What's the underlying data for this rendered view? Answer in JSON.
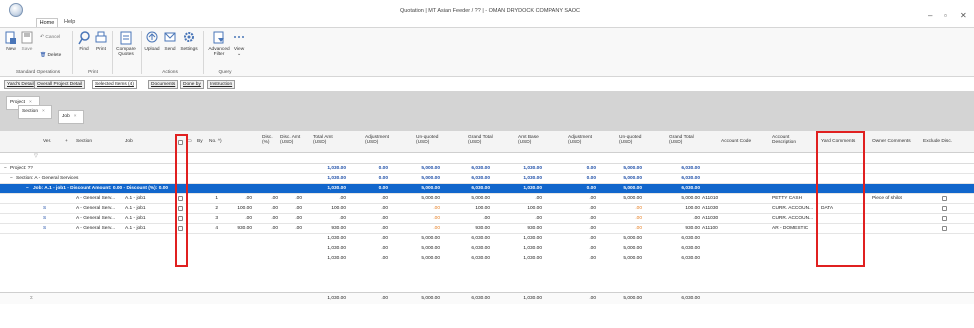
{
  "window": {
    "title": "Quotation | MT Asian Feeder / ?? | - OMAN DRYDOCK COMPANY SAOC",
    "controls": [
      "–",
      "▫",
      "✕"
    ]
  },
  "menu_tabs": [
    "Home",
    "Help"
  ],
  "ribbon": {
    "buttons": {
      "new": "New",
      "save": "Save",
      "cancel": "Cancel",
      "delete": "Delete",
      "find": "Find",
      "print": "Print",
      "compare": "Compare Quotes",
      "upload": "Upload",
      "send": "Send",
      "settings": "Settings",
      "advanced_filter": "Advanced Filter",
      "view": "View"
    },
    "groups": {
      "standard": "Standard Operations",
      "print": "Print",
      "actions": "Actions",
      "query": "Query"
    }
  },
  "panel_tabs": [
    "Yard's Detail",
    "Overall Project Detail",
    "Selected Items (4)",
    "Documents",
    "Done by",
    "Instruction"
  ],
  "group_by": [
    "Project",
    "Section",
    "Job"
  ],
  "columns": {
    "ver": "Ver.",
    "plus": "+",
    "section": "Section",
    "job": "Job",
    "by": "By",
    "no": "No.",
    "disc_pct": "Disc. (%)",
    "disc_amt": "Disc. Amt (USD)",
    "total_amt": "Total Amt (USD)",
    "adjustment": "Adjustment (USD)",
    "unquoted": "Un-quoted (USD)",
    "grand_total": "Grand Total (USD)",
    "amt_base": "Amt Base (USD)",
    "adjustment2": "Adjustment (USD)",
    "unquoted2": "Un-quoted (USD)",
    "grand_total2": "Grand Total (USD)",
    "account_code": "Account Code",
    "account_desc": "Account Description",
    "yard_comments": "Yard Comments",
    "owner_comments": "Owner Comments",
    "exclude_disc": "Exclude Disc."
  },
  "groups": {
    "project": {
      "label": "Project: ??",
      "total_amt": "1,030.00",
      "adjustment": "0.00",
      "unquoted": "5,000.00",
      "grand_total": "6,030.00",
      "amt_base": "1,030.00",
      "adjustment2": "0.00",
      "unquoted2": "5,000.00",
      "grand_total2": "6,030.00"
    },
    "section": {
      "label": "Section: A - General Services",
      "total_amt": "1,030.00",
      "adjustment": "0.00",
      "unquoted": "5,000.00",
      "grand_total": "6,030.00",
      "amt_base": "1,030.00",
      "adjustment2": "0.00",
      "unquoted2": "5,000.00",
      "grand_total2": "6,030.00"
    },
    "job": {
      "label": "Job: A.1 - job1 - Discount Amount: 0.00 - Discount (%): 0.00",
      "total_amt": "1,030.00",
      "adjustment": "0.00",
      "unquoted": "5,000.00",
      "grand_total": "6,030.00",
      "amt_base": "1,030.00",
      "adjustment2": "0.00",
      "unquoted2": "5,000.00",
      "grand_total2": "6,030.00"
    }
  },
  "rows": [
    {
      "ver": "",
      "section": "A - General Serv...",
      "job": "A.1 - job1",
      "no": "1",
      "col1": ".00",
      "disc_pct": ".00",
      "disc_amt": ".00",
      "total_amt": ".00",
      "adjustment": ".00",
      "unquoted": "5,000.00",
      "grand_total": "5,000.00",
      "amt_base": ".00",
      "adjustment2": ".00",
      "unquoted2": "5,000.00",
      "grand_total2": "5,000.00",
      "account_code": "A11010",
      "account_desc": "PETTY CASH",
      "yard_comments": "",
      "owner_comments": "Piece of shilot"
    },
    {
      "ver": "S",
      "section": "A - General Serv...",
      "job": "A.1 - job1",
      "no": "2",
      "col1": "100.00",
      "disc_pct": ".00",
      "disc_amt": ".00",
      "total_amt": "100.00",
      "adjustment": ".00",
      "unquoted": ".00",
      "grand_total": "100.00",
      "amt_base": "100.00",
      "adjustment2": ".00",
      "unquoted2": ".00",
      "grand_total2": "100.00",
      "account_code": "A11030",
      "account_desc": "CURR. ACCOUN...",
      "yard_comments": "DATA",
      "owner_comments": ""
    },
    {
      "ver": "S",
      "section": "A - General Serv...",
      "job": "A.1 - job1",
      "no": "3",
      "col1": ".00",
      "disc_pct": ".00",
      "disc_amt": ".00",
      "total_amt": ".00",
      "adjustment": ".00",
      "unquoted": ".00",
      "grand_total": ".00",
      "amt_base": ".00",
      "adjustment2": ".00",
      "unquoted2": ".00",
      "grand_total2": ".00",
      "account_code": "A11030",
      "account_desc": "CURR. ACCOUN...",
      "yard_comments": "",
      "owner_comments": ""
    },
    {
      "ver": "S",
      "section": "A - General Serv...",
      "job": "A.1 - job1",
      "no": "4",
      "col1": "930.00",
      "disc_pct": ".00",
      "disc_amt": ".00",
      "total_amt": "930.00",
      "adjustment": ".00",
      "unquoted": ".00",
      "grand_total": "930.00",
      "amt_base": "930.00",
      "adjustment2": ".00",
      "unquoted2": ".00",
      "grand_total2": "930.00",
      "account_code": "A11100",
      "account_desc": "AR - DOMESTIC",
      "yard_comments": "",
      "owner_comments": ""
    }
  ],
  "summaries": [
    {
      "total_amt": "1,030.00",
      "adjustment": ".00",
      "unquoted": "5,000.00",
      "grand_total": "6,030.00",
      "amt_base": "1,030.00",
      "adjustment2": ".00",
      "unquoted2": "5,000.00",
      "grand_total2": "6,030.00"
    },
    {
      "total_amt": "1,030.00",
      "adjustment": ".00",
      "unquoted": "5,000.00",
      "grand_total": "6,030.00",
      "amt_base": "1,030.00",
      "adjustment2": ".00",
      "unquoted2": "5,000.00",
      "grand_total2": "6,030.00"
    },
    {
      "total_amt": "1,030.00",
      "adjustment": ".00",
      "unquoted": "5,000.00",
      "grand_total": "6,030.00",
      "amt_base": "1,030.00",
      "adjustment2": ".00",
      "unquoted2": "5,000.00",
      "grand_total2": "6,030.00"
    }
  ],
  "footer": {
    "total_amt": "1,030.00",
    "adjustment": ".00",
    "unquoted": "5,000.00",
    "grand_total": "6,030.00",
    "amt_base": "1,030.00",
    "adjustment2": ".00",
    "unquoted2": "5,000.00",
    "grand_total2": "6,030.00"
  },
  "colors": {
    "selection": "#1166cc",
    "group_total": "#1f4fa8",
    "highlight": "#e02020",
    "zero_orange": "#e67e22"
  }
}
